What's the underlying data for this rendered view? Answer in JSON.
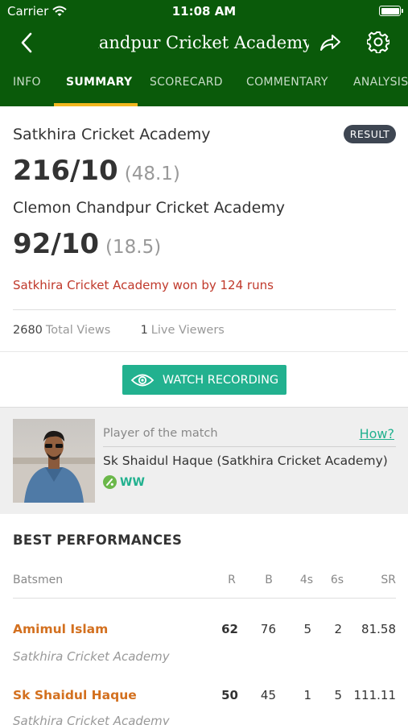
{
  "status_bar": {
    "carrier": "Carrier",
    "time": "11:08 AM"
  },
  "navbar": {
    "title": "Satkhira Cricket Academy vs Clemon Chandpur Cricket Academy"
  },
  "tabs": [
    {
      "label": "INFO",
      "active": false
    },
    {
      "label": "SUMMARY",
      "active": true
    },
    {
      "label": "SCORECARD",
      "active": false
    },
    {
      "label": "COMMENTARY",
      "active": false
    },
    {
      "label": "ANALYSIS",
      "active": false
    }
  ],
  "summary": {
    "team1": {
      "name": "Satkhira Cricket Academy",
      "score": "216/10",
      "overs": "(48.1)"
    },
    "team2": {
      "name": "Clemon Chandpur Cricket Academy",
      "score": "92/10",
      "overs": "(18.5)"
    },
    "badge": "RESULT",
    "result_text": "Satkhira Cricket Academy won by 124 runs",
    "total_views": "2680",
    "total_views_label": "Total Views",
    "live_viewers": "1",
    "live_viewers_label": "Live Viewers"
  },
  "watch_button": {
    "label": "WATCH RECORDING"
  },
  "player_of_match": {
    "label": "Player of the match",
    "how_link": "How?",
    "name": "Sk Shaidul Haque (Satkhira Cricket Academy)",
    "role": "WW"
  },
  "best_performances": {
    "title": "BEST PERFORMANCES",
    "headers": {
      "name": "Batsmen",
      "r": "R",
      "b": "B",
      "fours": "4s",
      "sixes": "6s",
      "sr": "SR"
    },
    "rows": [
      {
        "name": "Amimul Islam",
        "team": "Satkhira Cricket Academy",
        "r": "62",
        "b": "76",
        "fours": "5",
        "sixes": "2",
        "sr": "81.58"
      },
      {
        "name": "Sk Shaidul Haque",
        "team": "Satkhira Cricket Academy",
        "r": "50",
        "b": "45",
        "fours": "1",
        "sixes": "5",
        "sr": "111.11"
      }
    ]
  },
  "colors": {
    "header_bg": "#0a5a0a",
    "tab_indicator": "#f2b71e",
    "accent": "#22b18f",
    "result_text": "#c0392b",
    "batsman_name": "#d3701f"
  },
  "icons": {
    "back": "chevron-left-icon",
    "share": "share-icon",
    "settings": "gear-icon",
    "watch": "eye-icon",
    "role": "cricket-ball-icon"
  }
}
